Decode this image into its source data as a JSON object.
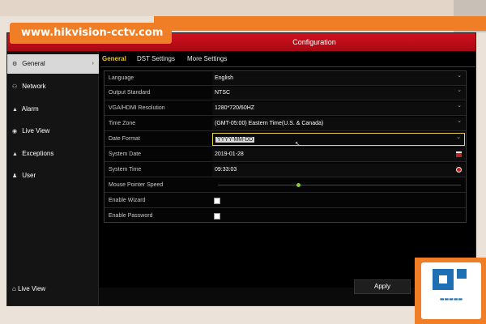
{
  "banner": {
    "text": "www.hikvision-cctv.com"
  },
  "window": {
    "title": "Configuration"
  },
  "sidebar": {
    "items": [
      {
        "icon": "gear-icon",
        "glyph": "⚙",
        "label": "General",
        "active": true
      },
      {
        "icon": "network-icon",
        "glyph": "⚇",
        "label": "Network"
      },
      {
        "icon": "alarm-icon",
        "glyph": "▲",
        "label": "Alarm"
      },
      {
        "icon": "live-view-icon",
        "glyph": "◉",
        "label": "Live View"
      },
      {
        "icon": "exceptions-icon",
        "glyph": "▲",
        "label": "Exceptions"
      },
      {
        "icon": "user-icon",
        "glyph": "♟",
        "label": "User"
      }
    ],
    "bottom": {
      "icon": "home-icon",
      "glyph": "⌂",
      "label": "Live View"
    }
  },
  "tabs": [
    {
      "label": "General",
      "active": true
    },
    {
      "label": "DST Settings"
    },
    {
      "label": "More Settings"
    }
  ],
  "settings": {
    "language": {
      "label": "Language",
      "value": "English"
    },
    "output_standard": {
      "label": "Output Standard",
      "value": "NTSC"
    },
    "resolution": {
      "label": "VGA/HDMI Resolution",
      "value": "1280*720/60HZ"
    },
    "time_zone": {
      "label": "Time Zone",
      "value": "(GMT-05:00) Eastern Time(U.S. & Canada)"
    },
    "date_format": {
      "label": "Date Format",
      "value": "YYYY-MM-DD"
    },
    "system_date": {
      "label": "System Date",
      "value": "2019-01-28"
    },
    "system_time": {
      "label": "System Time",
      "value": "09:33:03"
    },
    "pointer_speed": {
      "label": "Mouse Pointer Speed",
      "level": 0.33
    },
    "wizard": {
      "label": "Enable Wizard",
      "checked": false
    },
    "password": {
      "label": "Enable Password",
      "checked": false
    }
  },
  "actions": {
    "apply_label": "Apply"
  },
  "colors": {
    "accent_orange": "#f07e26",
    "title_red": "#c8101e",
    "tab_active": "#e8c430",
    "logo_blue": "#1f6fb5"
  }
}
